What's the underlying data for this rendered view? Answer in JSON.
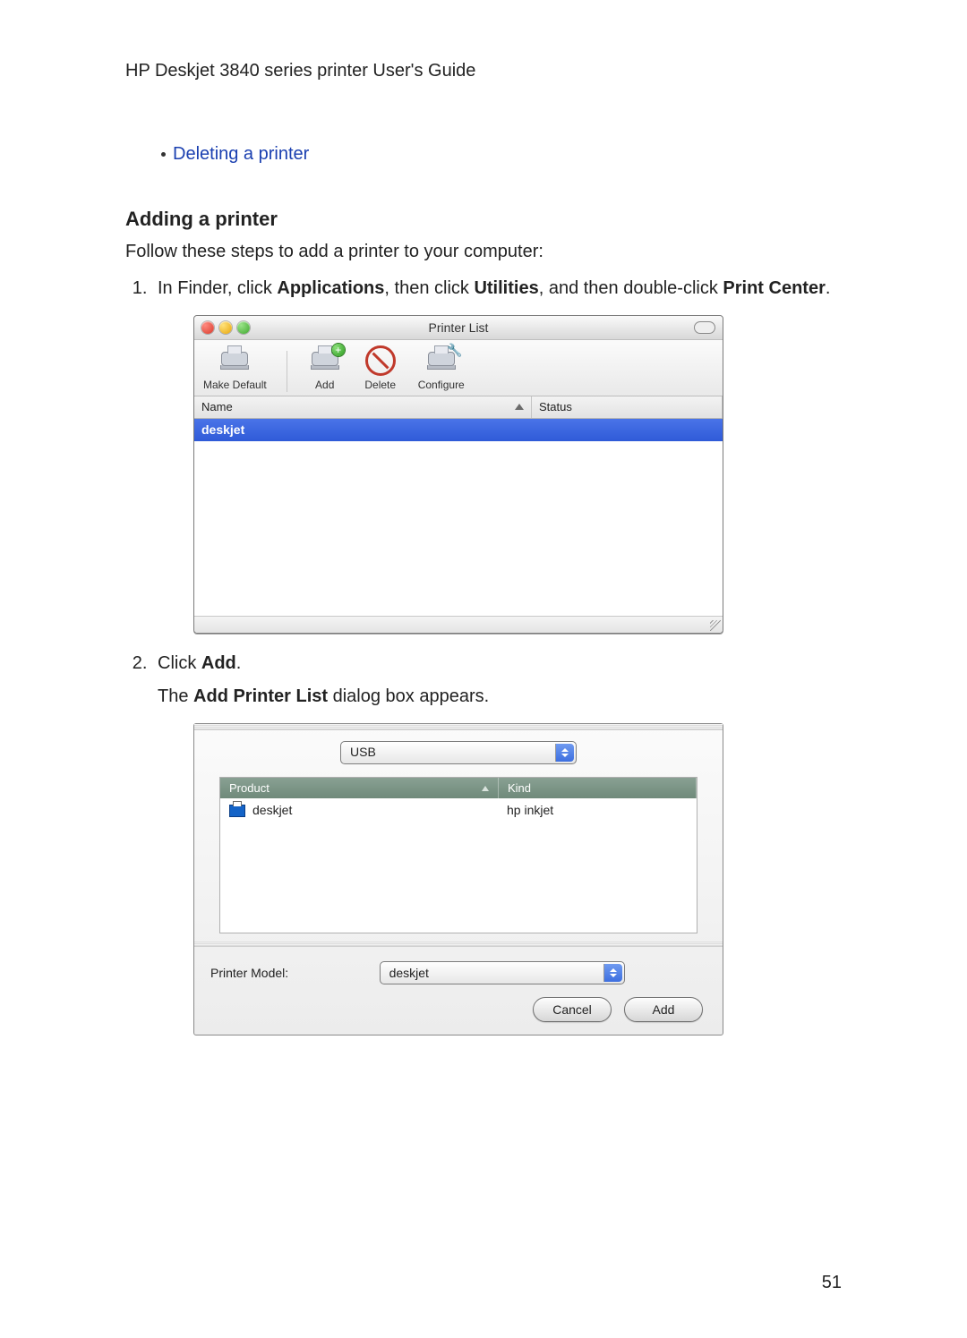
{
  "header": "HP Deskjet 3840 series printer User's Guide",
  "toc_link": "Deleting a printer",
  "section_heading": "Adding a printer",
  "intro": "Follow these steps to add a printer to your computer:",
  "step1": {
    "pre": "In Finder, click ",
    "b1": "Applications",
    "mid1": ", then click ",
    "b2": "Utilities",
    "mid2": ", and then double-click ",
    "b3": "Print Center",
    "post": "."
  },
  "step2a": {
    "pre": "Click ",
    "b1": "Add",
    "post": "."
  },
  "step2b": {
    "pre": "The ",
    "b1": "Add Printer List",
    "post": " dialog box appears."
  },
  "printer_list_window": {
    "title": "Printer List",
    "toolbar": {
      "make_default": "Make Default",
      "add": "Add",
      "delete": "Delete",
      "configure": "Configure"
    },
    "columns": {
      "name": "Name",
      "status": "Status"
    },
    "rows": [
      {
        "name": "deskjet",
        "status": ""
      }
    ]
  },
  "add_dialog": {
    "connection_popup": "USB",
    "columns": {
      "product": "Product",
      "kind": "Kind"
    },
    "rows": [
      {
        "product": "deskjet",
        "kind": "hp inkjet"
      }
    ],
    "model_label": "Printer Model:",
    "model_value": "deskjet",
    "cancel": "Cancel",
    "add": "Add"
  },
  "page_number": "51"
}
